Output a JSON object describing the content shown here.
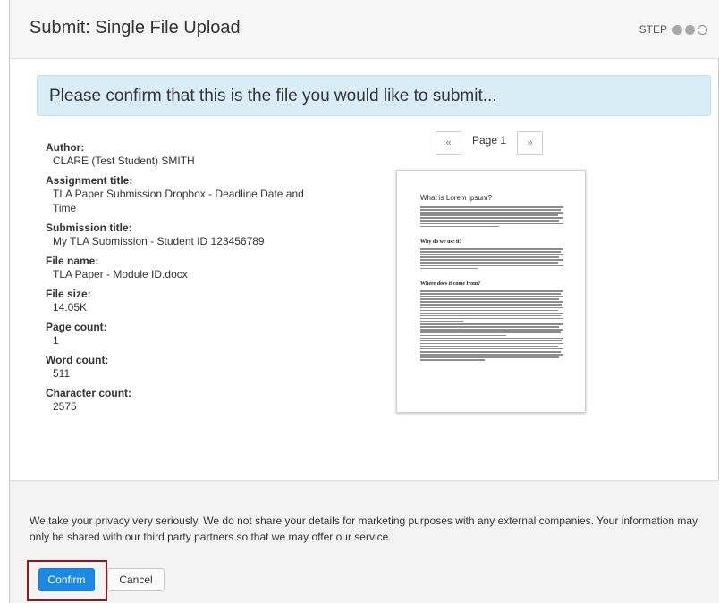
{
  "header": {
    "title": "Submit: Single File Upload",
    "step_label": "STEP",
    "steps_completed": 2,
    "steps_total": 3
  },
  "banner": {
    "text": "Please confirm that this is the file you would like to submit..."
  },
  "details": [
    {
      "label": "Author:",
      "value": "CLARE (Test Student) SMITH"
    },
    {
      "label": "Assignment title:",
      "value": "TLA Paper Submission Dropbox - Deadline Date and Time"
    },
    {
      "label": "Submission title:",
      "value": "My TLA Submission - Student ID 123456789"
    },
    {
      "label": "File name:",
      "value": "TLA Paper - Module ID.docx"
    },
    {
      "label": "File size:",
      "value": "14.05K"
    },
    {
      "label": "Page count:",
      "value": "1"
    },
    {
      "label": "Word count:",
      "value": "511"
    },
    {
      "label": "Character count:",
      "value": "2575"
    }
  ],
  "pager": {
    "prev": "«",
    "label": "Page 1",
    "next": "»"
  },
  "preview": {
    "title": "What is Lorem Ipsum?",
    "heading_1": "Why do we use it?",
    "heading_2": "Where does it come from?"
  },
  "footer": {
    "privacy_text": "We take your privacy very seriously. We do not share your details for marketing purposes with any external companies. Your information may only be shared with our third party partners so that we may offer our service.",
    "confirm_label": "Confirm",
    "cancel_label": "Cancel"
  },
  "colors": {
    "banner_bg": "#d9edf7",
    "confirm_bg": "#1e88e5",
    "highlight_border": "#8b1a1a"
  }
}
